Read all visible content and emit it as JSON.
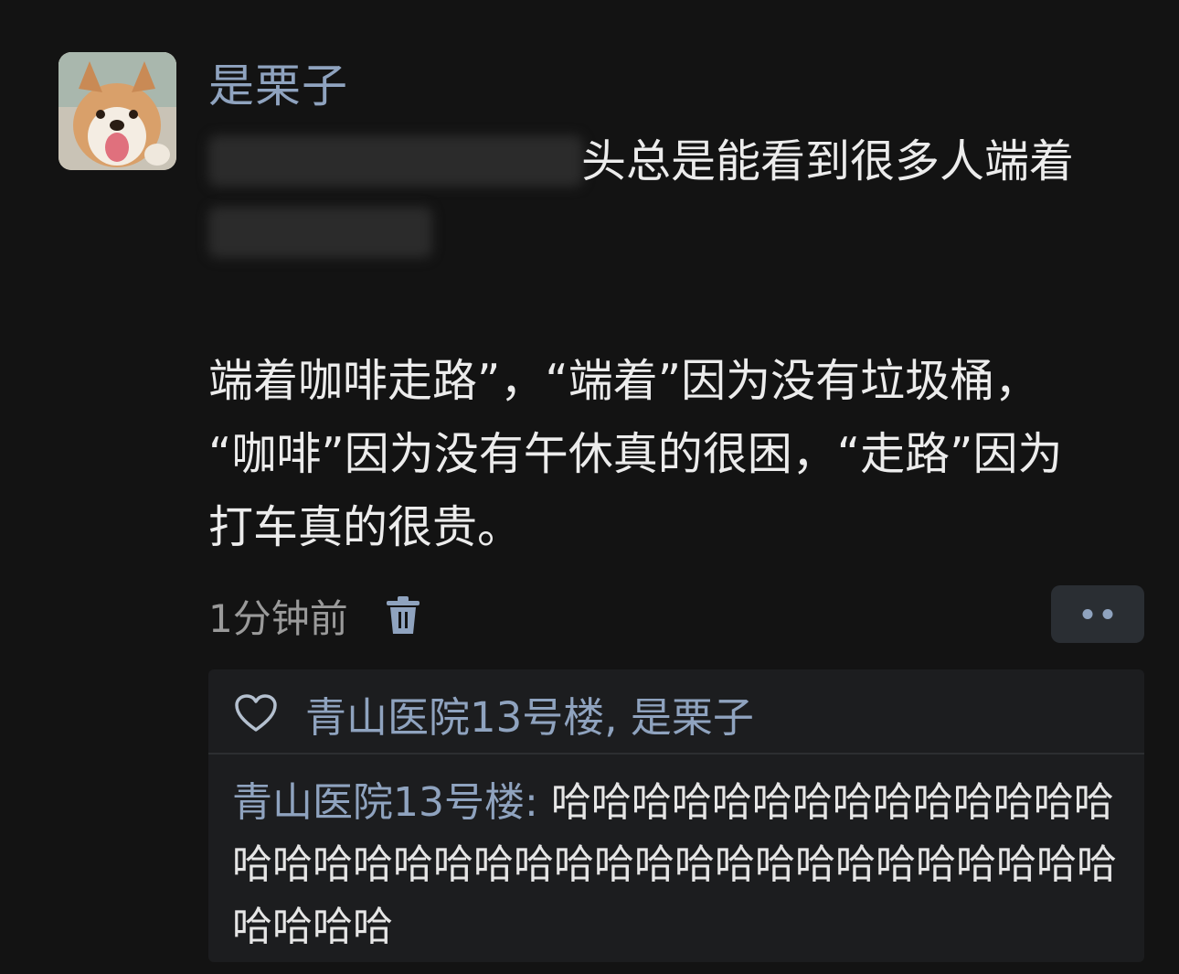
{
  "post": {
    "author": "是栗子",
    "line1_visible": "头总是能看到很多人端着",
    "line2": "端着咖啡走路”，“端着”因为没有垃圾桶，",
    "line3": "“咖啡”因为没有午休真的很困，“走路”因为",
    "line4": "打车真的很贵。",
    "timestamp": "1分钟前"
  },
  "icons": {
    "avatar": "shiba-dog-avatar",
    "delete": "trash-icon",
    "more": "more-dots-icon",
    "like": "heart-icon"
  },
  "likes": {
    "names": "青山医院13号楼, 是栗子"
  },
  "comment": {
    "author": "青山医院13号楼",
    "separator": ": ",
    "text": "哈哈哈哈哈哈哈哈哈哈哈哈哈哈哈哈哈哈哈哈哈哈哈哈哈哈哈哈哈哈哈哈哈哈哈哈哈哈哈哈"
  },
  "colors": {
    "background": "#131313",
    "link": "#8fa3bf",
    "text": "#ececec",
    "muted": "#9a9a9a"
  }
}
